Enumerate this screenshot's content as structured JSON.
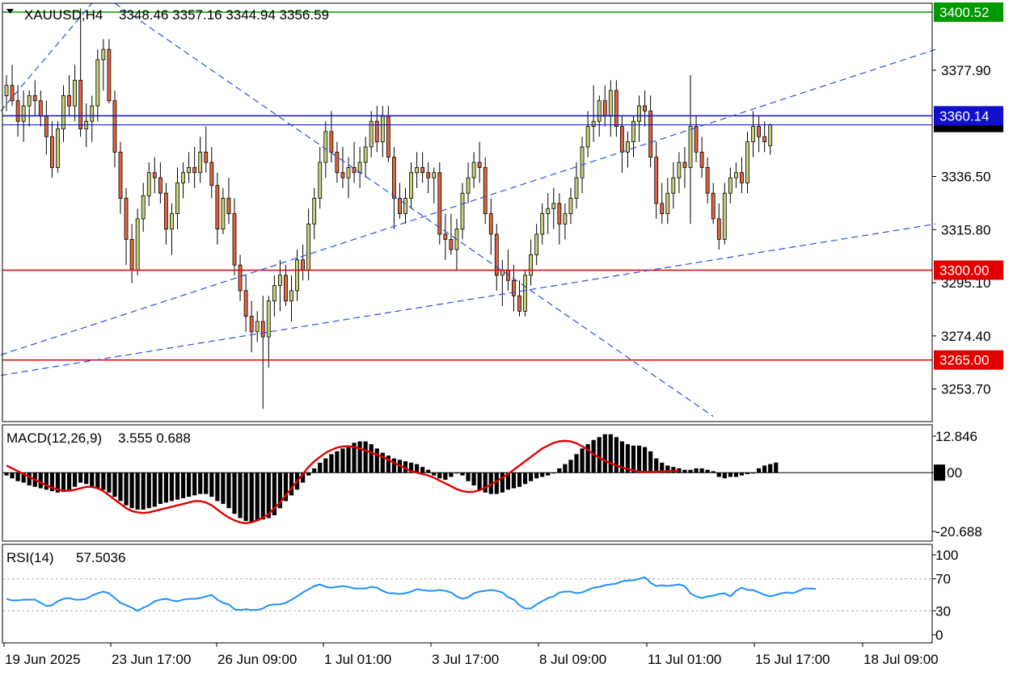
{
  "header": {
    "symbol": "XAUUSD,H4",
    "ohlc": "3348.46 3357.16 3344.94 3356.59"
  },
  "colors": {
    "bull_candle": "#c8d07a",
    "bear_candle": "#e3663f",
    "candle_outline": "#000000",
    "support_line": "#e00000",
    "resistance_line": "#0000cc",
    "trend_line": "#2b50d8",
    "signal_line": "#e00000",
    "rsi_line": "#1e90ff",
    "histogram": "#000000",
    "label_green": "#009900",
    "label_red": "#e00000",
    "label_blue": "#1010cc"
  },
  "chart_data": [
    {
      "type": "candlestick",
      "title": "XAUUSD,H4",
      "ylim": [
        3241.0,
        3404.0
      ],
      "y_ticks": [
        3377.9,
        3336.5,
        3315.8,
        3295.1,
        3274.4,
        3253.7
      ],
      "x_ticks": [
        "19 Jun 2025",
        "23 Jun 17:00",
        "26 Jun 09:00",
        "1 Jul 01:00",
        "3 Jul 17:00",
        "8 Jul 09:00",
        "11 Jul 01:00",
        "15 Jul 17:00",
        "18 Jul 09:00"
      ],
      "horizontal_levels": [
        {
          "value": 3400.52,
          "color": "#009900",
          "label": "3400.52"
        },
        {
          "value": 3360.14,
          "color": "#1010cc",
          "label": "3360.14"
        },
        {
          "value": 3300.0,
          "color": "#e00000",
          "label": "3300.00"
        },
        {
          "value": 3265.0,
          "color": "#e00000",
          "label": "3265.00"
        }
      ],
      "current_price": 3356.59,
      "candles": [
        [
          3368,
          3376,
          3362,
          3372
        ],
        [
          3372,
          3380,
          3364,
          3366
        ],
        [
          3366,
          3372,
          3352,
          3358
        ],
        [
          3358,
          3370,
          3350,
          3364
        ],
        [
          3364,
          3370,
          3356,
          3368
        ],
        [
          3368,
          3374,
          3360,
          3366
        ],
        [
          3366,
          3370,
          3356,
          3360
        ],
        [
          3360,
          3366,
          3345,
          3352
        ],
        [
          3352,
          3358,
          3336,
          3340
        ],
        [
          3340,
          3358,
          3338,
          3355
        ],
        [
          3355,
          3372,
          3350,
          3368
        ],
        [
          3368,
          3376,
          3360,
          3364
        ],
        [
          3364,
          3380,
          3358,
          3374
        ],
        [
          3374,
          3402,
          3352,
          3355
        ],
        [
          3355,
          3365,
          3348,
          3358
        ],
        [
          3358,
          3368,
          3350,
          3364
        ],
        [
          3364,
          3386,
          3358,
          3382
        ],
        [
          3382,
          3390,
          3370,
          3386
        ],
        [
          3386,
          3390,
          3365,
          3366
        ],
        [
          3366,
          3370,
          3340,
          3346
        ],
        [
          3346,
          3350,
          3322,
          3328
        ],
        [
          3328,
          3332,
          3302,
          3312
        ],
        [
          3312,
          3318,
          3295,
          3300
        ],
        [
          3300,
          3324,
          3298,
          3320
        ],
        [
          3320,
          3334,
          3315,
          3329
        ],
        [
          3329,
          3342,
          3325,
          3338
        ],
        [
          3338,
          3344,
          3330,
          3336
        ],
        [
          3336,
          3342,
          3326,
          3330
        ],
        [
          3330,
          3334,
          3310,
          3316
        ],
        [
          3316,
          3326,
          3306,
          3322
        ],
        [
          3322,
          3340,
          3316,
          3334
        ],
        [
          3334,
          3342,
          3328,
          3338
        ],
        [
          3338,
          3346,
          3334,
          3340
        ],
        [
          3340,
          3348,
          3332,
          3338
        ],
        [
          3338,
          3352,
          3334,
          3346
        ],
        [
          3346,
          3356,
          3338,
          3342
        ],
        [
          3342,
          3348,
          3328,
          3333
        ],
        [
          3333,
          3338,
          3310,
          3316
        ],
        [
          3316,
          3332,
          3314,
          3328
        ],
        [
          3328,
          3336,
          3318,
          3322
        ],
        [
          3322,
          3328,
          3298,
          3302
        ],
        [
          3302,
          3306,
          3288,
          3292
        ],
        [
          3292,
          3298,
          3276,
          3282
        ],
        [
          3282,
          3288,
          3268,
          3276
        ],
        [
          3276,
          3284,
          3272,
          3280
        ],
        [
          3280,
          3290,
          3246,
          3274
        ],
        [
          3274,
          3290,
          3262,
          3288
        ],
        [
          3288,
          3298,
          3282,
          3294
        ],
        [
          3294,
          3304,
          3284,
          3298
        ],
        [
          3298,
          3302,
          3286,
          3288
        ],
        [
          3288,
          3298,
          3280,
          3292
        ],
        [
          3292,
          3308,
          3288,
          3304
        ],
        [
          3304,
          3310,
          3296,
          3300
        ],
        [
          3300,
          3324,
          3296,
          3318
        ],
        [
          3318,
          3332,
          3312,
          3328
        ],
        [
          3328,
          3348,
          3324,
          3342
        ],
        [
          3342,
          3358,
          3336,
          3354
        ],
        [
          3354,
          3362,
          3342,
          3346
        ],
        [
          3346,
          3350,
          3334,
          3338
        ],
        [
          3338,
          3348,
          3332,
          3336
        ],
        [
          3336,
          3344,
          3328,
          3340
        ],
        [
          3340,
          3350,
          3334,
          3338
        ],
        [
          3338,
          3348,
          3332,
          3342
        ],
        [
          3342,
          3352,
          3336,
          3348
        ],
        [
          3348,
          3362,
          3344,
          3358
        ],
        [
          3358,
          3364,
          3346,
          3350
        ],
        [
          3350,
          3364,
          3344,
          3360
        ],
        [
          3360,
          3364,
          3342,
          3344
        ],
        [
          3344,
          3348,
          3316,
          3328
        ],
        [
          3328,
          3334,
          3320,
          3322
        ],
        [
          3322,
          3332,
          3318,
          3328
        ],
        [
          3328,
          3342,
          3324,
          3338
        ],
        [
          3338,
          3346,
          3332,
          3340
        ],
        [
          3340,
          3346,
          3334,
          3338
        ],
        [
          3338,
          3342,
          3330,
          3336
        ],
        [
          3336,
          3340,
          3326,
          3338
        ],
        [
          3338,
          3342,
          3310,
          3314
        ],
        [
          3314,
          3322,
          3304,
          3312
        ],
        [
          3312,
          3322,
          3306,
          3308
        ],
        [
          3308,
          3320,
          3300,
          3316
        ],
        [
          3316,
          3334,
          3312,
          3330
        ],
        [
          3330,
          3342,
          3326,
          3336
        ],
        [
          3336,
          3346,
          3332,
          3342
        ],
        [
          3342,
          3350,
          3334,
          3340
        ],
        [
          3340,
          3344,
          3318,
          3322
        ],
        [
          3322,
          3328,
          3306,
          3314
        ],
        [
          3314,
          3318,
          3292,
          3298
        ],
        [
          3298,
          3304,
          3286,
          3300
        ],
        [
          3300,
          3308,
          3292,
          3296
        ],
        [
          3296,
          3302,
          3284,
          3290
        ],
        [
          3290,
          3296,
          3282,
          3284
        ],
        [
          3284,
          3300,
          3282,
          3298
        ],
        [
          3298,
          3312,
          3294,
          3306
        ],
        [
          3306,
          3318,
          3302,
          3314
        ],
        [
          3314,
          3326,
          3310,
          3322
        ],
        [
          3322,
          3330,
          3314,
          3324
        ],
        [
          3324,
          3332,
          3316,
          3326
        ],
        [
          3326,
          3330,
          3310,
          3318
        ],
        [
          3318,
          3326,
          3312,
          3322
        ],
        [
          3322,
          3332,
          3318,
          3328
        ],
        [
          3328,
          3342,
          3324,
          3336
        ],
        [
          3336,
          3352,
          3330,
          3348
        ],
        [
          3348,
          3362,
          3344,
          3356
        ],
        [
          3356,
          3372,
          3350,
          3358
        ],
        [
          3358,
          3368,
          3352,
          3366
        ],
        [
          3366,
          3372,
          3356,
          3360
        ],
        [
          3360,
          3374,
          3352,
          3370
        ],
        [
          3370,
          3374,
          3352,
          3356
        ],
        [
          3356,
          3360,
          3338,
          3346
        ],
        [
          3346,
          3354,
          3340,
          3350
        ],
        [
          3350,
          3360,
          3344,
          3358
        ],
        [
          3358,
          3368,
          3350,
          3364
        ],
        [
          3364,
          3370,
          3356,
          3362
        ],
        [
          3362,
          3368,
          3340,
          3344
        ],
        [
          3344,
          3350,
          3320,
          3326
        ],
        [
          3326,
          3334,
          3318,
          3322
        ],
        [
          3322,
          3336,
          3318,
          3330
        ],
        [
          3330,
          3342,
          3324,
          3336
        ],
        [
          3336,
          3346,
          3330,
          3342
        ],
        [
          3342,
          3348,
          3332,
          3340
        ],
        [
          3340,
          3376,
          3318,
          3356
        ],
        [
          3356,
          3360,
          3342,
          3346
        ],
        [
          3346,
          3352,
          3336,
          3340
        ],
        [
          3340,
          3344,
          3326,
          3330
        ],
        [
          3330,
          3334,
          3318,
          3320
        ],
        [
          3320,
          3326,
          3308,
          3312
        ],
        [
          3312,
          3334,
          3310,
          3330
        ],
        [
          3330,
          3340,
          3326,
          3336
        ],
        [
          3336,
          3342,
          3332,
          3338
        ],
        [
          3338,
          3344,
          3330,
          3334
        ],
        [
          3334,
          3354,
          3330,
          3350
        ],
        [
          3350,
          3362,
          3344,
          3356
        ],
        [
          3356,
          3360,
          3346,
          3352
        ],
        [
          3352,
          3358,
          3346,
          3350
        ],
        [
          3348.46,
          3357.16,
          3344.94,
          3356.59
        ]
      ]
    },
    {
      "type": "bar",
      "title": "MACD(12,26,9)",
      "values_text": "3.555 0.688",
      "ylim": [
        -20.688,
        12.846
      ],
      "y_ticks": [
        12.846,
        0.0,
        -20.688
      ],
      "main": [
        -1.0,
        -2.0,
        -3.0,
        -3.5,
        -4.5,
        -5.0,
        -5.5,
        -6.0,
        -6.5,
        -7.0,
        -6.8,
        -6.0,
        -5.0,
        -3.5,
        -4.0,
        -5.0,
        -5.5,
        -6.0,
        -7.0,
        -8.5,
        -10.0,
        -11.5,
        -12.5,
        -13.0,
        -13.0,
        -12.5,
        -12.0,
        -11.0,
        -10.5,
        -10.0,
        -9.5,
        -9.0,
        -8.5,
        -8.0,
        -7.5,
        -7.5,
        -8.5,
        -10.0,
        -11.0,
        -12.5,
        -14.5,
        -16.0,
        -17.0,
        -17.5,
        -17.0,
        -16.5,
        -16.0,
        -15.0,
        -12.5,
        -10.0,
        -8.0,
        -6.0,
        -3.5,
        -1.0,
        1.5,
        3.5,
        5.0,
        6.5,
        7.5,
        8.5,
        9.5,
        10.5,
        11.0,
        11.0,
        10.0,
        8.5,
        7.0,
        6.0,
        5.0,
        4.5,
        4.0,
        3.5,
        3.0,
        2.0,
        1.0,
        -1.0,
        -2.0,
        -2.5,
        -1.5,
        0.0,
        -1.0,
        -3.0,
        -4.5,
        -6.0,
        -7.0,
        -7.5,
        -7.5,
        -7.0,
        -6.0,
        -5.5,
        -5.0,
        -4.0,
        -3.0,
        -2.0,
        -1.5,
        -1.0,
        0.0,
        1.5,
        3.0,
        4.5,
        6.5,
        8.5,
        10.0,
        11.5,
        12.5,
        13.5,
        13.5,
        12.5,
        11.0,
        10.0,
        9.5,
        9.5,
        9.0,
        7.5,
        5.0,
        3.5,
        2.5,
        2.0,
        1.5,
        1.0,
        1.0,
        1.5,
        1.5,
        1.0,
        0.5,
        -1.5,
        -2.0,
        -1.5,
        -1.5,
        -1.0,
        -0.5,
        0.0,
        1.5,
        2.5,
        3.0,
        3.555
      ],
      "signal": [
        2.5,
        1.5,
        0.5,
        -0.5,
        -1.5,
        -2.5,
        -3.5,
        -4.5,
        -5.3,
        -6.0,
        -6.3,
        -6.4,
        -6.0,
        -5.5,
        -5.0,
        -5.0,
        -5.5,
        -6.5,
        -8.0,
        -9.5,
        -11.0,
        -12.5,
        -13.5,
        -14.0,
        -14.2,
        -14.0,
        -13.5,
        -13.0,
        -12.5,
        -12.0,
        -11.5,
        -11.0,
        -10.5,
        -10.0,
        -10.0,
        -10.5,
        -11.5,
        -13.0,
        -14.5,
        -15.8,
        -16.8,
        -17.5,
        -17.8,
        -17.5,
        -16.8,
        -15.8,
        -14.5,
        -12.5,
        -10.5,
        -8.0,
        -5.5,
        -3.0,
        -0.5,
        2.0,
        4.0,
        5.5,
        7.0,
        8.0,
        8.8,
        9.2,
        9.3,
        9.0,
        8.5,
        7.8,
        7.0,
        6.3,
        5.5,
        4.5,
        3.5,
        2.5,
        1.5,
        0.5,
        0.0,
        -0.5,
        -1.0,
        -1.8,
        -2.8,
        -3.8,
        -4.8,
        -5.8,
        -6.5,
        -6.8,
        -6.7,
        -6.2,
        -5.3,
        -4.2,
        -3.0,
        -1.8,
        -0.5,
        1.0,
        2.5,
        4.0,
        5.5,
        7.0,
        8.5,
        9.5,
        10.5,
        11.0,
        11.2,
        11.0,
        10.3,
        9.3,
        8.0,
        6.5,
        5.2,
        4.2,
        3.3,
        2.5,
        1.8,
        1.2,
        0.8,
        0.4,
        0.2,
        0.2,
        0.3,
        0.4,
        0.5,
        0.6,
        0.688
      ]
    },
    {
      "type": "line",
      "title": "RSI(14)",
      "values_text": "57.5036",
      "ylim": [
        0,
        100
      ],
      "y_ticks": [
        100,
        70,
        30,
        0
      ],
      "levels": [
        70,
        30
      ],
      "values": [
        45,
        43,
        43,
        44,
        44,
        44,
        40,
        36,
        37,
        42,
        45,
        46,
        44,
        44,
        45,
        49,
        52,
        54,
        52,
        46,
        40,
        37,
        34,
        30,
        34,
        37,
        42,
        44,
        45,
        43,
        42,
        44,
        45,
        45,
        46,
        48,
        50,
        44,
        40,
        38,
        32,
        31,
        32,
        31,
        31,
        33,
        37,
        38,
        38,
        40,
        44,
        48,
        53,
        57,
        61,
        63,
        60,
        59,
        60,
        61,
        60,
        58,
        58,
        58,
        60,
        59,
        55,
        52,
        52,
        51,
        52,
        54,
        57,
        56,
        55,
        55,
        56,
        55,
        53,
        48,
        45,
        47,
        52,
        54,
        55,
        56,
        55,
        53,
        47,
        44,
        37,
        33,
        33,
        38,
        42,
        46,
        48,
        53,
        54,
        54,
        52,
        53,
        56,
        59,
        60,
        62,
        63,
        64,
        67,
        68,
        68,
        70,
        72,
        65,
        61,
        62,
        61,
        62,
        63,
        61,
        52,
        48,
        46,
        48,
        49,
        51,
        52,
        48,
        55,
        59,
        56,
        56,
        53,
        50,
        48,
        50,
        52,
        53,
        52,
        55,
        58,
        58,
        57.5
      ]
    }
  ]
}
